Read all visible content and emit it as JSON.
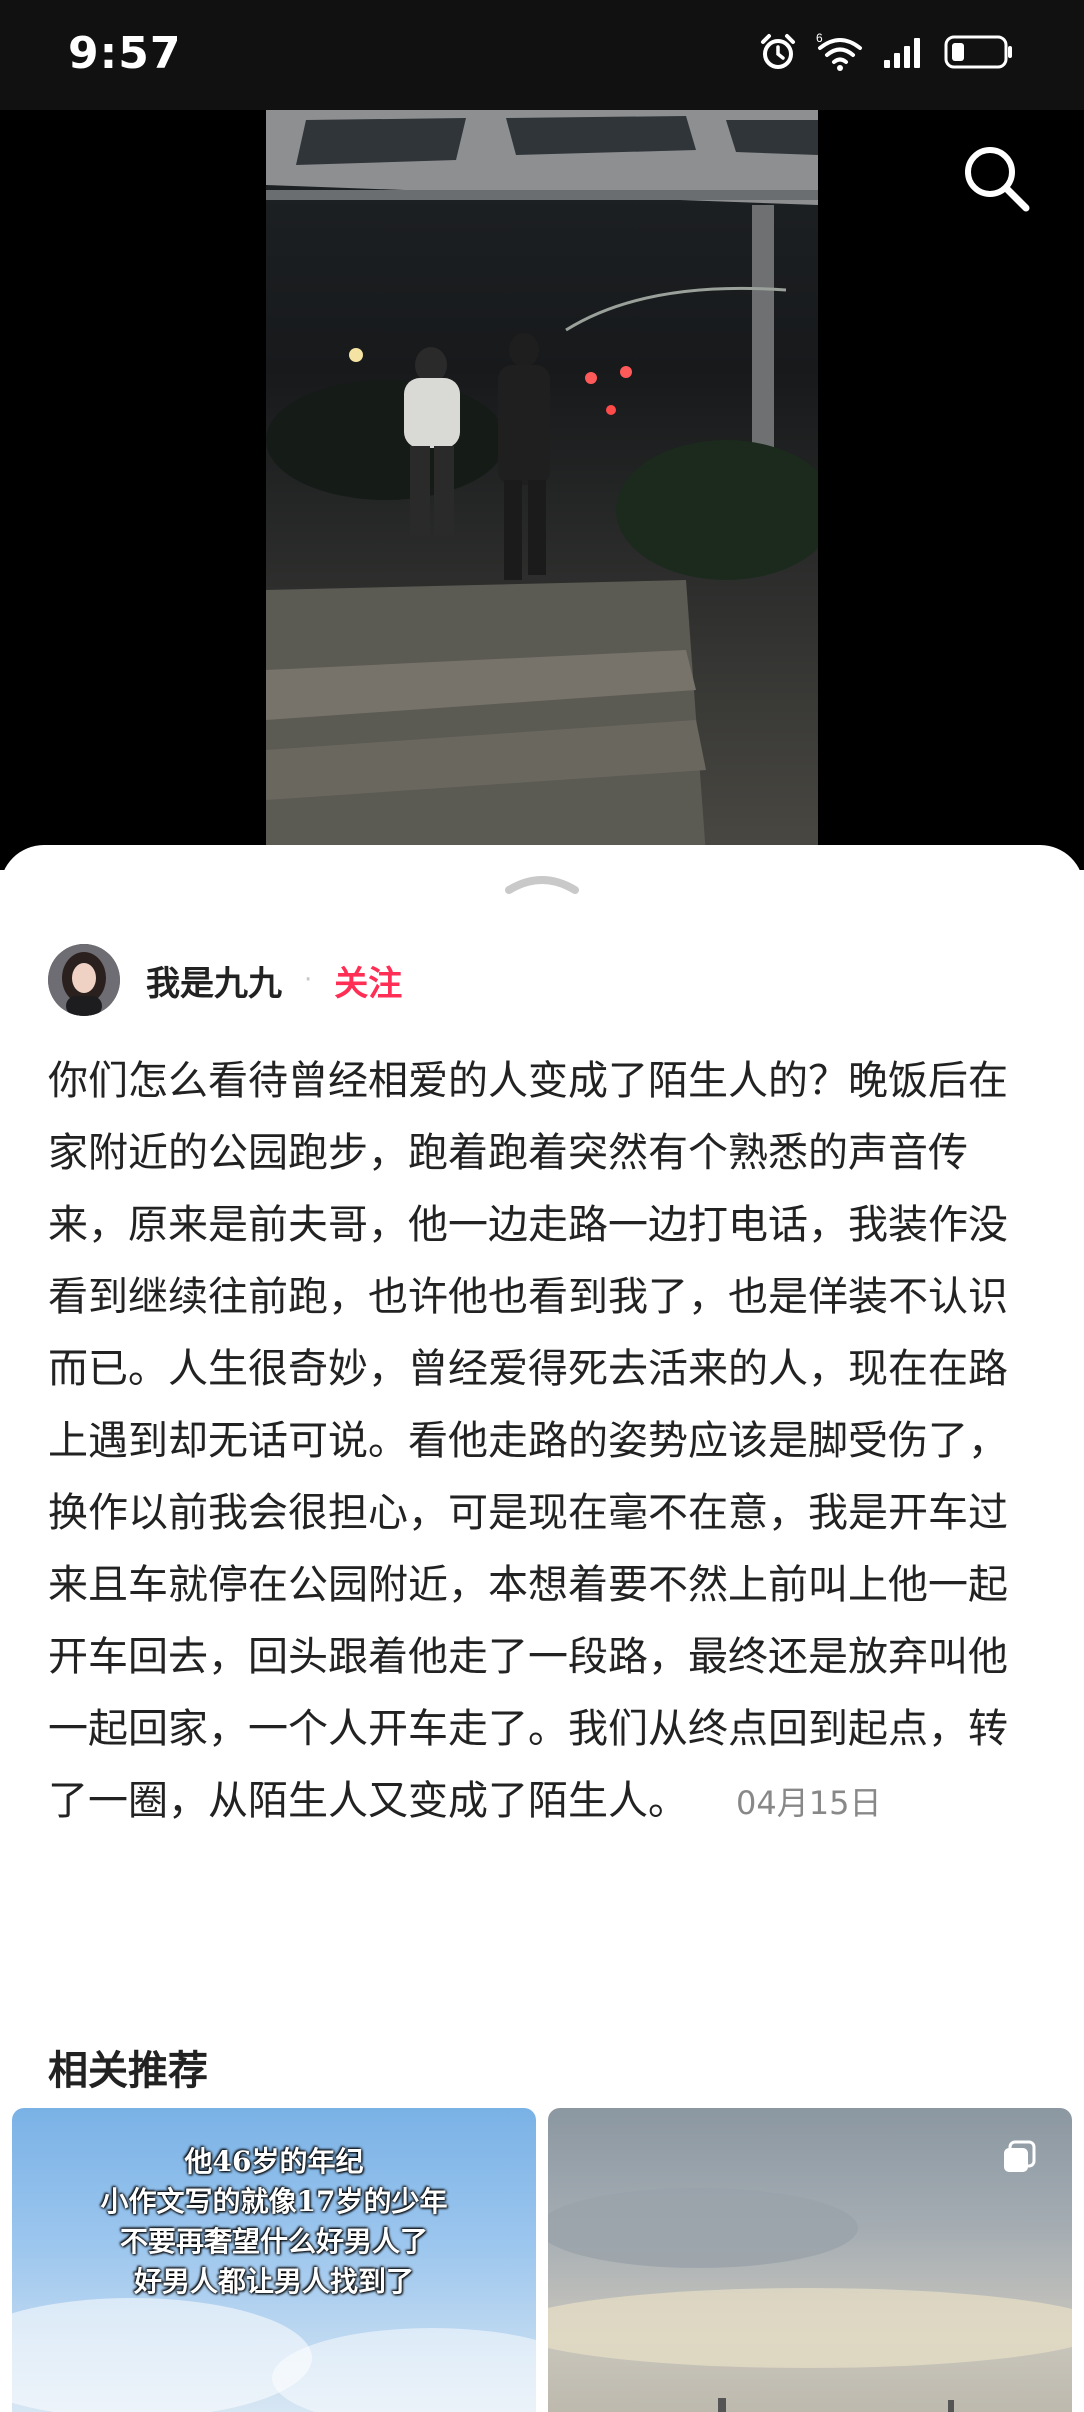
{
  "status_bar": {
    "time": "9:57",
    "icons": [
      "alarm-icon",
      "wifi-icon",
      "cellular-signal-icon",
      "battery-icon"
    ],
    "wifi_badge": "6"
  },
  "video": {
    "search_icon": "search-icon"
  },
  "author": {
    "name": "我是九九",
    "separator": "·",
    "follow_label": "关注",
    "follow_color": "#ff2e55"
  },
  "post": {
    "text": "你们怎么看待曾经相爱的人变成了陌生人的？晚饭后在家附近的公园跑步，跑着跑着突然有个熟悉的声音传来，原来是前夫哥，他一边走路一边打电话，我装作没看到继续往前跑，也许他也看到我了，也是佯装不认识而已。人生很奇妙，曾经爱得死去活来的人，现在在路上遇到却无话可说。看他走路的姿势应该是脚受伤了，换作以前我会很担心，可是现在毫不在意，我是开车过来且车就停在公园附近，本想着要不然上前叫上他一起开车回去，回头跟着他走了一段路，最终还是放弃叫他一起回家，一个人开车走了。我们从终点回到起点，转了一圈，从陌生人又变成了陌生人。",
    "date": "04月15日"
  },
  "recommendations": {
    "title": "相关推荐",
    "cards": [
      {
        "lines": [
          "他46岁的年纪",
          "小作文写的就像17岁的少年",
          "不要再奢望什么好男人了",
          "好男人都让男人找到了"
        ]
      },
      {
        "lines": [],
        "badge_icon": "multi-image-icon"
      }
    ]
  }
}
